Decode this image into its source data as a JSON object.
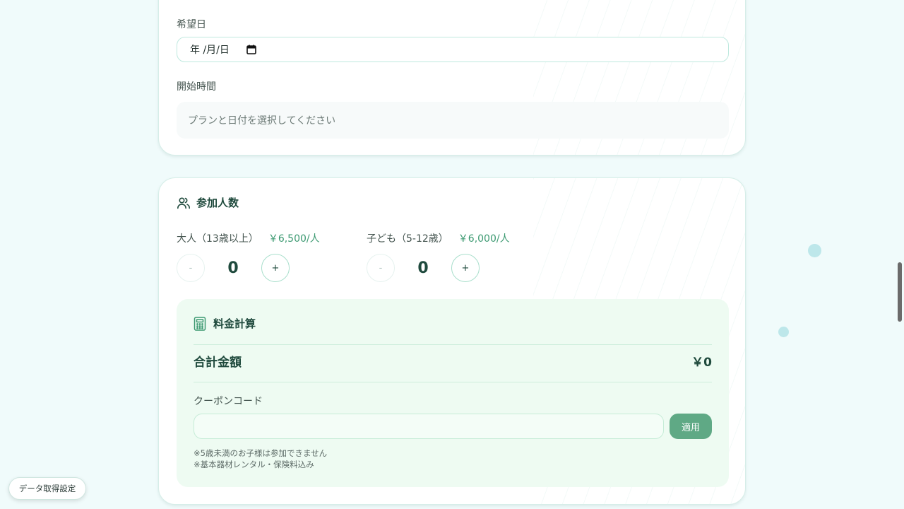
{
  "colors": {
    "background": "#f0fbfb",
    "accent": "#3d9a72",
    "heading": "#1f4a3d",
    "apply_button": "#5fa985",
    "fee_box": "#eefbf2"
  },
  "schedule": {
    "date_label": "希望日",
    "date_value": "年 /月/日",
    "time_label": "開始時間",
    "time_placeholder": "プランと日付を選択してください"
  },
  "participants": {
    "title": "参加人数",
    "icon": "users-icon",
    "adult": {
      "label": "大人（13歳以上）",
      "price": "￥6,500/人",
      "count": "0",
      "minus": "-",
      "plus": "+"
    },
    "child": {
      "label": "子ども（5-12歳）",
      "price": "￥6,000/人",
      "count": "0",
      "minus": "-",
      "plus": "+"
    }
  },
  "fee": {
    "title": "料金計算",
    "icon": "calculator-icon",
    "total_label": "合計金額",
    "total_value": "￥0",
    "coupon_label": "クーポンコード",
    "coupon_value": "",
    "coupon_placeholder": "",
    "apply_label": "適用",
    "notes": [
      "※5歳未満のお子様は参加できません",
      "※基本器材レンタル・保険料込み"
    ]
  },
  "floating": {
    "data_settings_label": "データ取得設定"
  }
}
